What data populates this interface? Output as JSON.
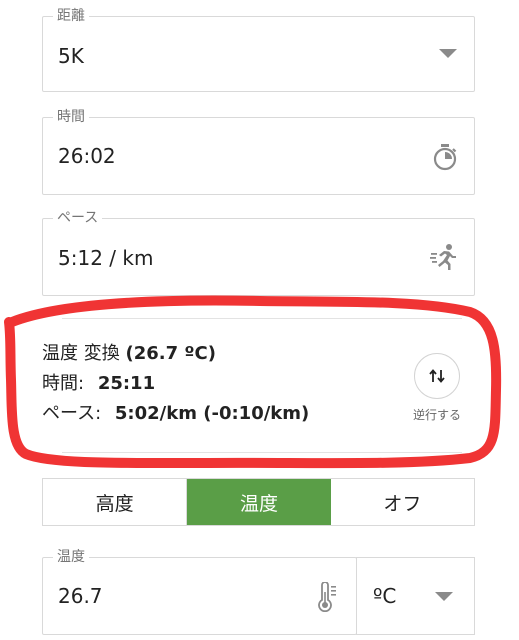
{
  "distance": {
    "label": "距離",
    "value": "5K",
    "icon": "chevron-down-icon"
  },
  "time": {
    "label": "時間",
    "value": "26:02",
    "icon": "stopwatch-icon"
  },
  "pace": {
    "label": "ペース",
    "value": "5:12 / km",
    "icon": "runner-icon"
  },
  "conversion": {
    "title_prefix": "温度 変換",
    "title_value": "(26.7 ºC)",
    "time_label": "時間:",
    "time_value": "25:11",
    "pace_label": "ペース:",
    "pace_value": "5:02/km (-0:10/km)",
    "reverse_label": "逆行する",
    "reverse_icon": "swap-vertical-icon"
  },
  "mode_tabs": [
    {
      "label": "高度",
      "active": false
    },
    {
      "label": "温度",
      "active": true
    },
    {
      "label": "オフ",
      "active": false
    }
  ],
  "temperature": {
    "label": "温度",
    "value": "26.7",
    "icon": "thermometer-icon"
  },
  "unit": {
    "value": "ºC",
    "icon": "chevron-down-icon"
  },
  "colors": {
    "accent_green": "#5a9e47",
    "annotation_red": "#f03434",
    "border": "#d9d9d9"
  }
}
